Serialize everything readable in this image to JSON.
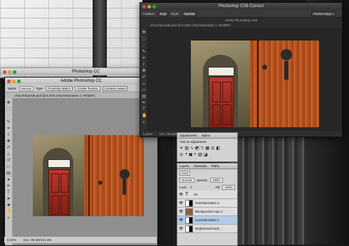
{
  "background_window": {
    "title": "Photoshop CC"
  },
  "cc_window": {
    "title": "Adobe Photoshop CC",
    "options": {
      "mode_label": "Mode:",
      "mode_value": "Normal",
      "type_label": "Type:",
      "type_value": "Proximity Match",
      "create_texture": "Create Texture",
      "content_aware": "Content-Aware"
    },
    "doc_tab": "churchdoorsdt.psd @ 6.25% (Hue/Saturation 1, RGB/8*)",
    "status": {
      "zoom": "6.25%",
      "doc": "Doc: 99.3M/161.2M"
    }
  },
  "cs6_window": {
    "title": "Adobe Photoshop CS6",
    "app_label": "Photoshop CS6 Correct",
    "options": {
      "feather_label": "Feather:",
      "feather_value": "0 px",
      "style_label": "Style:",
      "style_value": "Normal",
      "refine_edge": "Refine Edge..."
    },
    "doc_tab": "churchdoorsdt.psd @ 6.25% (Hue/Saturation 1, RGB/8*)",
    "status": {
      "zoom": "6.25%",
      "doc": "Doc: 99.3M/161.2M"
    }
  },
  "adjustments_panel": {
    "tabs": [
      "Adjustments",
      "Styles"
    ],
    "hint": "Add an adjustment"
  },
  "layers_panel": {
    "tabs": [
      "Layers",
      "Channels",
      "Paths"
    ],
    "kind": "Kind",
    "blend": "Normal",
    "opacity_label": "Opacity:",
    "opacity_value": "100%",
    "lock_label": "Lock:",
    "fill_label": "Fill:",
    "fill_value": "100%",
    "layers": [
      {
        "name": "art",
        "type": "text",
        "selected": false
      },
      {
        "name": "Hue/Saturation 2",
        "type": "adj",
        "selected": false
      },
      {
        "name": "Background copy 3",
        "type": "img",
        "selected": false
      },
      {
        "name": "Hue/Saturation 1",
        "type": "adj",
        "selected": true
      },
      {
        "name": "Brightness/Contr...",
        "type": "adj",
        "selected": false
      }
    ]
  },
  "colors": {
    "door_red": "#9c2a1f",
    "wood_orange": "#b4501e",
    "selection_blue": "#b3cbe8"
  }
}
